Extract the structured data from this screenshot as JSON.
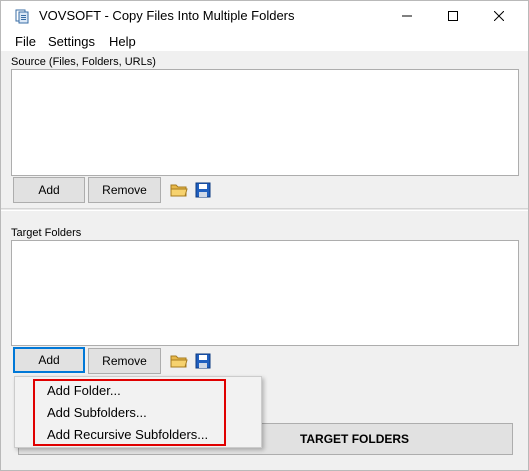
{
  "window": {
    "title": "VOVSOFT - Copy Files Into Multiple Folders",
    "controls": {
      "minimize": "minimize",
      "maximize": "maximize",
      "close": "close"
    }
  },
  "menu": {
    "items": [
      "File",
      "Settings",
      "Help"
    ]
  },
  "source": {
    "label": "Source (Files, Folders, URLs)",
    "add_label": "Add",
    "remove_label": "Remove"
  },
  "target": {
    "label": "Target Folders",
    "add_label": "Add",
    "remove_label": "Remove"
  },
  "popup_menu": {
    "items": [
      "Add Folder...",
      "Add Subfolders...",
      "Add Recursive Subfolders..."
    ]
  },
  "action": {
    "label_visible": "TARGET FOLDERS"
  },
  "icons": {
    "open": "folder-open-icon",
    "save": "save-icon"
  },
  "colors": {
    "folder": "#e8b84a",
    "save": "#1f5fbf",
    "focus": "#0078d7",
    "highlight": "#e00000"
  }
}
